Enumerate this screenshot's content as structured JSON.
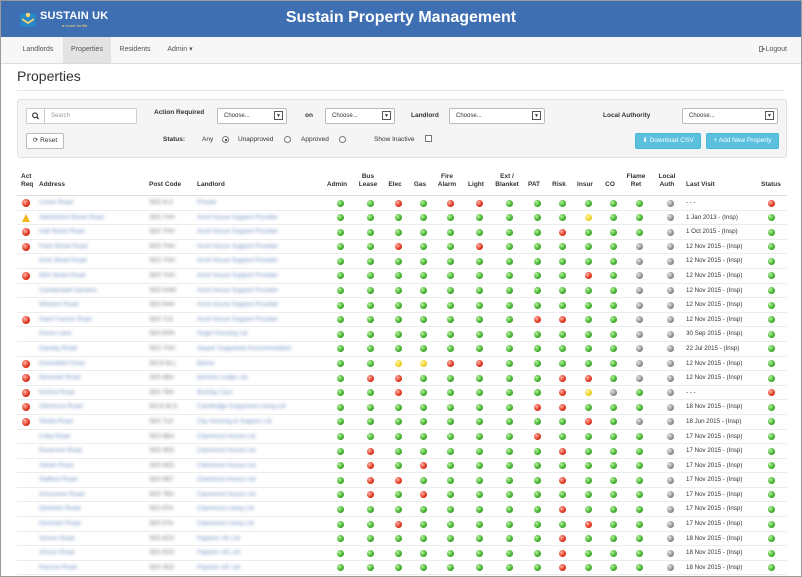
{
  "brand": {
    "logo_text": "SUSTAIN UK",
    "logo_tagline": "a home for life",
    "app_title": "Sustain Property Management"
  },
  "nav": {
    "items": [
      {
        "label": "Landlords",
        "active": false
      },
      {
        "label": "Properties",
        "active": true
      },
      {
        "label": "Residents",
        "active": false
      },
      {
        "label": "Admin",
        "active": false
      }
    ],
    "admin_caret": "▾",
    "logout_icon": "logout-icon",
    "logout_label": "Logout"
  },
  "page": {
    "title": "Properties"
  },
  "filters": {
    "search_placeholder": "Search",
    "action_required_label": "Action Required",
    "action_required_value": "Choose...",
    "on_label": "on",
    "on_value": "Choose...",
    "landlord_label": "Landlord",
    "landlord_value": "Choose...",
    "local_authority_label": "Local Authority",
    "local_authority_value": "Choose...",
    "reset_label": "Reset",
    "status_label": "Status:",
    "status_options": [
      "Any",
      "Unapproved",
      "Approved"
    ],
    "status_selected": "Any",
    "show_inactive_label": "Show Inactive",
    "show_inactive_checked": false,
    "download_csv_label": "Download CSV",
    "add_property_label": "+ Add New Property"
  },
  "table": {
    "headers": {
      "act_req_1": "Act",
      "act_req_2": "Req",
      "address": "Address",
      "post_code": "Post Code",
      "landlord": "Landlord",
      "admin": "Admin",
      "bus_lease_1": "Bus",
      "bus_lease_2": "Lease",
      "elec": "Elec",
      "gas": "Gas",
      "fire_alarm_1": "Fire",
      "fire_alarm_2": "Alarm",
      "light": "Light",
      "ext_blanket_1": "Ext /",
      "ext_blanket_2": "Blanket",
      "pat": "PAT",
      "risk": "Risk",
      "insur": "Insur",
      "co": "CO",
      "flame_ret_1": "Flame",
      "flame_ret_2": "Ret",
      "local_auth_1": "Local",
      "local_auth_2": "Auth",
      "last_visit": "Last Visit",
      "status": "Status"
    },
    "status_columns": [
      "admin",
      "bus_lease",
      "elec",
      "gas",
      "fire_alarm",
      "light",
      "ext_blanket",
      "pat",
      "risk",
      "insur",
      "co",
      "flame_ret",
      "local_auth"
    ],
    "rows": [
      {
        "act": "red",
        "address": "Lorem Road",
        "post_code": "SE5 0LX",
        "landlord": "Private",
        "s": "ggrgrrggggggx",
        "last_visit": "- - -",
        "status": "r"
      },
      {
        "act": "warn",
        "address": "Abbotsford Street Road",
        "post_code": "SE5 7HH",
        "landlord": "Anvil House Support Provider",
        "s": "gggggggggyggx",
        "last_visit": "1 Jan 2013 - (Insp)",
        "status": "g"
      },
      {
        "act": "red",
        "address": "Hall Street Road",
        "post_code": "SE5 7HH",
        "landlord": "Anvil House Support Provider",
        "s": "ggggggggrgggx",
        "last_visit": "1 Oct 2015 - (Insp)",
        "status": "g"
      },
      {
        "act": "red",
        "address": "Field Street Road",
        "post_code": "SE5 7HH",
        "landlord": "Anvil House Support Provider",
        "s": "ggrggrgggggxx",
        "last_visit": "12 Nov 2015 - (Insp)",
        "status": "g"
      },
      {
        "act": "",
        "address": "Kent Street Road",
        "post_code": "SE5 7HH",
        "landlord": "Anvil House Support Provider",
        "s": "gggggggggggxx",
        "last_visit": "12 Nov 2015 - (Insp)",
        "status": "g"
      },
      {
        "act": "red",
        "address": "Mint Street Road",
        "post_code": "SE5 7HH",
        "landlord": "Anvil House Support Provider",
        "s": "gggggggggrgxx",
        "last_visit": "12 Nov 2015 - (Insp)",
        "status": "g"
      },
      {
        "act": "",
        "address": "Camberwell Gardens",
        "post_code": "SE5 0HW",
        "landlord": "Anvil House Support Provider",
        "s": "gggggggggggxx",
        "last_visit": "12 Nov 2015 - (Insp)",
        "status": "g"
      },
      {
        "act": "",
        "address": "Western Road",
        "post_code": "SE5 9HH",
        "landlord": "Anvil House Support Provider",
        "s": "gggggggggggxx",
        "last_visit": "12 Nov 2015 - (Insp)",
        "status": "g"
      },
      {
        "act": "red",
        "address": "Saint Francis Road",
        "post_code": "SE5 7LE",
        "landlord": "Anvil House Support Provider",
        "s": "gggggggrrggxx",
        "last_visit": "12 Nov 2015 - (Insp)",
        "status": "g"
      },
      {
        "act": "",
        "address": "Grove Lane",
        "post_code": "SE5 8SN",
        "landlord": "Angel Housing Ltd",
        "s": "gggggggggggxx",
        "last_visit": "30 Sep 2015 - (Insp)",
        "status": "g"
      },
      {
        "act": "",
        "address": "Daneby Road",
        "post_code": "SE5 7HH",
        "landlord": "Jaspar Supported Accommodation",
        "s": "gggggggggggxx",
        "last_visit": "22 Jul 2015 - (Insp)",
        "status": "g"
      },
      {
        "act": "red",
        "address": "Greenfield Close",
        "post_code": "SE15 6LL",
        "landlord": "Barnis",
        "s": "ggyyrrgggggxx",
        "last_visit": "12 Nov 2015 - (Insp)",
        "status": "g"
      },
      {
        "act": "red",
        "address": "Denmark Road",
        "post_code": "SE5 9BA",
        "landlord": "Barnish Lodge Ltd",
        "s": "grrgggggrrgxx",
        "last_visit": "12 Nov 2015 - (Insp)",
        "status": "g"
      },
      {
        "act": "red",
        "address": "Kimbol Road",
        "post_code": "SE5 7BA",
        "landlord": "Bumfay Cars",
        "s": "ggrgggggryxgx",
        "last_visit": "- - -",
        "status": "r"
      },
      {
        "act": "red",
        "address": "Glenhurst Road",
        "post_code": "SE15 8LN",
        "landlord": "Cambridge Supported Living Ltd",
        "s": "gggggggrrgggx",
        "last_visit": "18 Nov 2015 - (Insp)",
        "status": "g"
      },
      {
        "act": "red",
        "address": "Sheila Road",
        "post_code": "SE5 7LE",
        "landlord": "City Housing & Support Ltd",
        "s": "gggggggggrgxx",
        "last_visit": "18 Jun 2015 - (Insp)",
        "status": "g"
      },
      {
        "act": "",
        "address": "Coby Road",
        "post_code": "SE5 9BA",
        "landlord": "Claremont House Ltd",
        "s": "gggggggrggggx",
        "last_visit": "17 Nov 2015 - (Insp)",
        "status": "g"
      },
      {
        "act": "",
        "address": "Reservoir Road",
        "post_code": "SE5 9ED",
        "landlord": "Claremont House Ltd",
        "s": "grggggggrgggx",
        "last_visit": "17 Nov 2015 - (Insp)",
        "status": "g"
      },
      {
        "act": "",
        "address": "Adrian Road",
        "post_code": "SE5 9ED",
        "landlord": "Claremont House Ltd",
        "s": "grgrggggggggx",
        "last_visit": "17 Nov 2015 - (Insp)",
        "status": "g"
      },
      {
        "act": "",
        "address": "Stafford Road",
        "post_code": "SE5 9BT",
        "landlord": "Claremont House Ltd",
        "s": "grrgggggrgggx",
        "last_visit": "17 Nov 2015 - (Insp)",
        "status": "g"
      },
      {
        "act": "",
        "address": "Grosvenor Road",
        "post_code": "SE5 7BA",
        "landlord": "Claremont House Ltd",
        "s": "grgrggggggggx",
        "last_visit": "17 Nov 2015 - (Insp)",
        "status": "g"
      },
      {
        "act": "",
        "address": "Denholm Road",
        "post_code": "SE5 9TA",
        "landlord": "Claremont Living Ltd",
        "s": "ggggggggrgggx",
        "last_visit": "17 Nov 2015 - (Insp)",
        "status": "g"
      },
      {
        "act": "",
        "address": "Denholm Road",
        "post_code": "SE5 9TA",
        "landlord": "Claremont Living Ltd",
        "s": "ggrggggggrggx",
        "last_visit": "17 Nov 2015 - (Insp)",
        "status": "g"
      },
      {
        "act": "",
        "address": "Vinson Road",
        "post_code": "SE5 6DX",
        "landlord": "Papanic UK Ltd",
        "s": "ggggggggrgggx",
        "last_visit": "18 Nov 2015 - (Insp)",
        "status": "g"
      },
      {
        "act": "",
        "address": "Vinson Road",
        "post_code": "SE5 6DX",
        "landlord": "Papanic UK Ltd",
        "s": "ggggggggrgggx",
        "last_visit": "18 Nov 2015 - (Insp)",
        "status": "g"
      },
      {
        "act": "",
        "address": "Ranson Road",
        "post_code": "SE5 3DZ",
        "landlord": "Papanic UK Ltd",
        "s": "ggggggggrgggx",
        "last_visit": "18 Nov 2015 - (Insp)",
        "status": "g"
      }
    ]
  },
  "colors": {
    "header_bg": "#3f6fb3",
    "green": "#3fae2a",
    "red": "#e0331c",
    "yellow": "#f0d21f",
    "grey": "#8d8d8d",
    "info_button": "#5bc0de"
  }
}
